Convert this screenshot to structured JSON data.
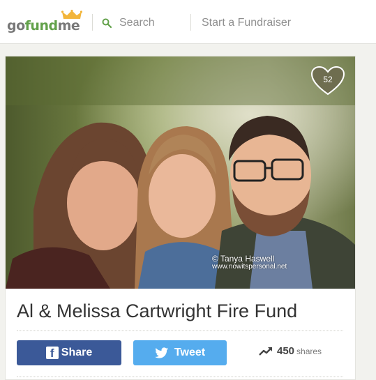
{
  "header": {
    "logo": {
      "go": "go",
      "fund": "fund",
      "me": "me"
    },
    "search_label": "Search",
    "start_label": "Start a Fundraiser"
  },
  "campaign": {
    "heart_count": "52",
    "photo_credit": "© Tanya Haswell",
    "photo_credit_url": "www.nowitspersonal.net",
    "title": "Al & Melissa Cartwright Fire Fund",
    "share_label": "Share",
    "tweet_label": "Tweet",
    "share_count": "450",
    "shares_label": "shares"
  },
  "colors": {
    "brand_green": "#62a14a",
    "facebook_blue": "#3b5998",
    "twitter_blue": "#55acee",
    "heart_overlay": "#6d6a4e"
  }
}
